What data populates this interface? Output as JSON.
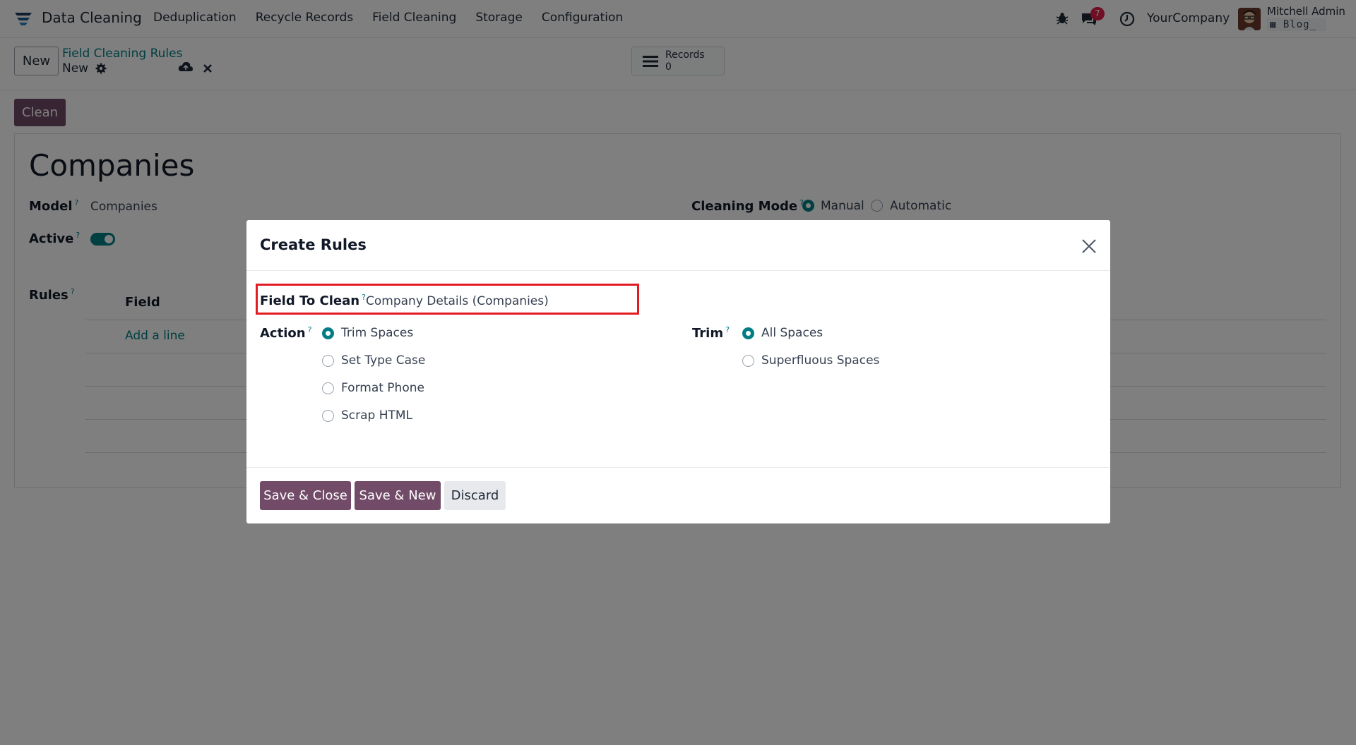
{
  "navbar": {
    "app_name": "Data Cleaning",
    "menu": [
      "Deduplication",
      "Recycle Records",
      "Field Cleaning",
      "Storage",
      "Configuration"
    ],
    "chat_badge": "7",
    "company": "YourCompany",
    "user_name": "Mitchell Admin",
    "db_name": "Blog_"
  },
  "control_panel": {
    "new_label": "New",
    "breadcrumb": "Field Cleaning Rules",
    "record_title": "New",
    "records_label": "Records",
    "records_count": "0"
  },
  "actions": {
    "clean_label": "Clean"
  },
  "form": {
    "title": "Companies",
    "model_label": "Model",
    "model_value": "Companies",
    "active_label": "Active",
    "cleaning_mode_label": "Cleaning Mode",
    "cleaning_mode_options": [
      "Manual",
      "Automatic"
    ],
    "rules_label": "Rules",
    "field_column": "Field",
    "add_line": "Add a line"
  },
  "dialog": {
    "title": "Create Rules",
    "field_to_clean_label": "Field To Clean",
    "field_to_clean_value": "Company Details (Companies)",
    "action_label": "Action",
    "action_options": [
      "Trim Spaces",
      "Set Type Case",
      "Format Phone",
      "Scrap HTML"
    ],
    "trim_label": "Trim",
    "trim_options": [
      "All Spaces",
      "Superfluous Spaces"
    ],
    "save_close": "Save & Close",
    "save_new": "Save & New",
    "discard": "Discard"
  },
  "colors": {
    "primary": "#714b67",
    "accent": "#017e84",
    "highlight": "#e31b23",
    "badge": "#e11d48"
  }
}
